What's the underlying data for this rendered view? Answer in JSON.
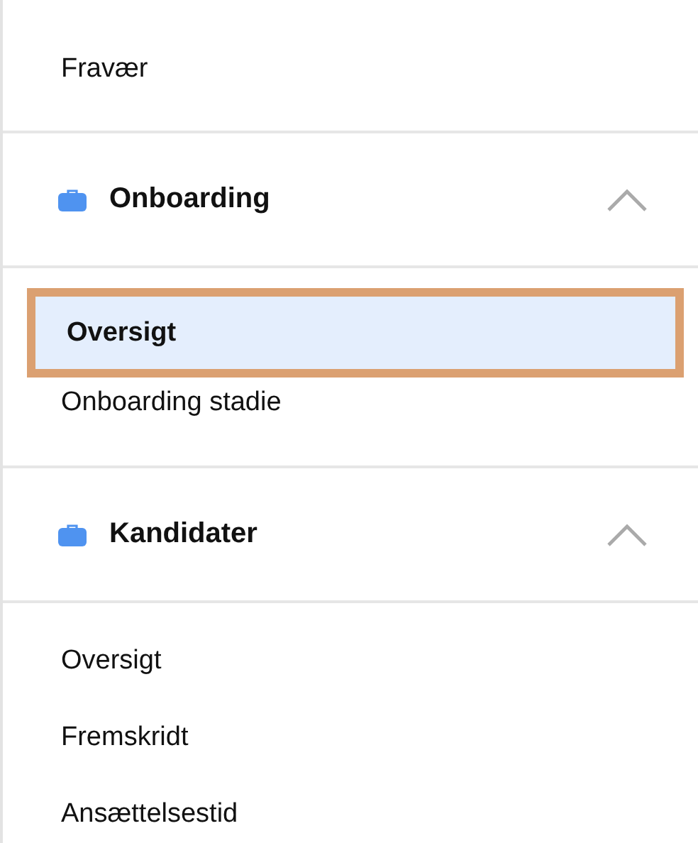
{
  "sections": [
    {
      "items": [
        {
          "label": "Fravær",
          "selected": false
        }
      ]
    },
    {
      "title": "Onboarding",
      "expanded": true,
      "items": [
        {
          "label": "Oversigt",
          "selected": true
        },
        {
          "label": "Onboarding stadie",
          "selected": false
        }
      ]
    },
    {
      "title": "Kandidater",
      "expanded": true,
      "items": [
        {
          "label": "Oversigt",
          "selected": false
        },
        {
          "label": "Fremskridt",
          "selected": false
        },
        {
          "label": "Ansættelsestid",
          "selected": false
        }
      ]
    }
  ]
}
